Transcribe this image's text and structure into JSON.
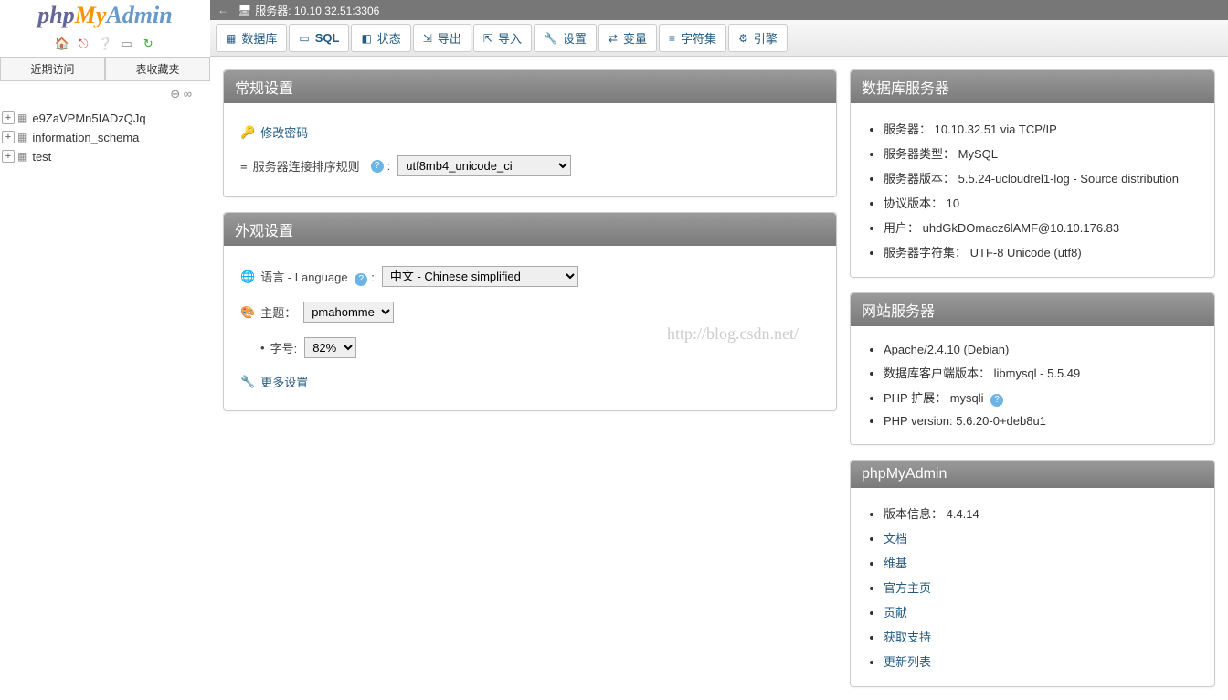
{
  "logo": {
    "php": "php",
    "my": "My",
    "admin": "Admin"
  },
  "sidebar": {
    "tabs": {
      "recent": "近期访问",
      "favorites": "表收藏夹"
    },
    "databases": [
      {
        "name": "e9ZaVPMn5IADzQJq"
      },
      {
        "name": "information_schema"
      },
      {
        "name": "test"
      }
    ]
  },
  "serverbar": {
    "label": "服务器: 10.10.32.51:3306"
  },
  "topmenu": {
    "db": "数据库",
    "sql": "SQL",
    "status": "状态",
    "export": "导出",
    "import": "导入",
    "settings": "设置",
    "variables": "变量",
    "charsets": "字符集",
    "engines": "引擎"
  },
  "general": {
    "title": "常规设置",
    "change_pw": "修改密码",
    "collation_label": "服务器连接排序规则",
    "collation_value": "utf8mb4_unicode_ci"
  },
  "appearance": {
    "title": "外观设置",
    "lang_label": "语言 - Language",
    "lang_value": "中文 - Chinese simplified",
    "theme_label": "主题：",
    "theme_value": "pmahomme",
    "fontsize_label": "字号:",
    "fontsize_value": "82%",
    "more": "更多设置"
  },
  "db_server": {
    "title": "数据库服务器",
    "items": [
      "服务器： 10.10.32.51 via TCP/IP",
      "服务器类型： MySQL",
      "服务器版本： 5.5.24-ucloudrel1-log - Source distribution",
      "协议版本： 10",
      "用户： uhdGkDOmacz6lAMF@10.10.176.83",
      "服务器字符集： UTF-8 Unicode (utf8)"
    ]
  },
  "web_server": {
    "title": "网站服务器",
    "items": [
      "Apache/2.4.10 (Debian)",
      "数据库客户端版本： libmysql - 5.5.49",
      "PHP 扩展： mysqli",
      "PHP version: 5.6.20-0+deb8u1"
    ]
  },
  "pma": {
    "title": "phpMyAdmin",
    "version": "版本信息： 4.4.14",
    "links": [
      "文档",
      "维基",
      "官方主页",
      "贡献",
      "获取支持",
      "更新列表"
    ]
  },
  "watermark": "http://blog.csdn.net/"
}
